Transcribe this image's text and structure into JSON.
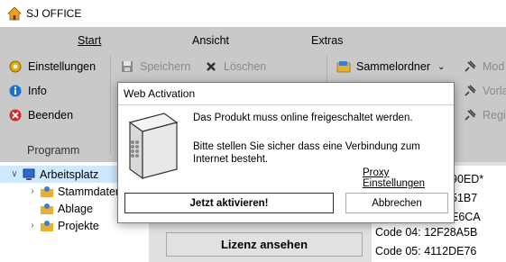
{
  "window": {
    "title": "SJ OFFICE"
  },
  "ribbon": {
    "tabs": [
      {
        "label": "Start"
      },
      {
        "label": "Ansicht"
      },
      {
        "label": "Extras"
      }
    ],
    "programm": {
      "items": [
        {
          "label": "Einstellungen"
        },
        {
          "label": "Info"
        },
        {
          "label": "Beenden"
        }
      ],
      "group_label": "Programm"
    },
    "edit": {
      "items": [
        {
          "label": "Speichern"
        },
        {
          "label": "Löschen"
        }
      ]
    },
    "folder": {
      "sammelordner": "Sammelordner",
      "partial": [
        "Mod",
        "Vorla",
        "Regi"
      ]
    }
  },
  "tree": {
    "items": [
      {
        "label": "Arbeitsplatz"
      },
      {
        "label": "Stammdaten"
      },
      {
        "label": "Ablage"
      },
      {
        "label": "Projekte"
      }
    ]
  },
  "main": {
    "button_label": "Lizenz ansehen",
    "codes": [
      "90ED*",
      "51B7",
      "E6CA",
      "Code 04: 12F28A5B",
      "Code 05: 4112DE76"
    ]
  },
  "dialog": {
    "title": "Web Activation",
    "message1": "Das Produkt muss online freigeschaltet werden.",
    "message2": "Bitte stellen Sie sicher dass eine Verbindung zum Internet besteht.",
    "proxy_link": "Proxy Einstellungen",
    "activate_button": "Jetzt aktivieren!",
    "cancel_button": "Abbrechen"
  }
}
